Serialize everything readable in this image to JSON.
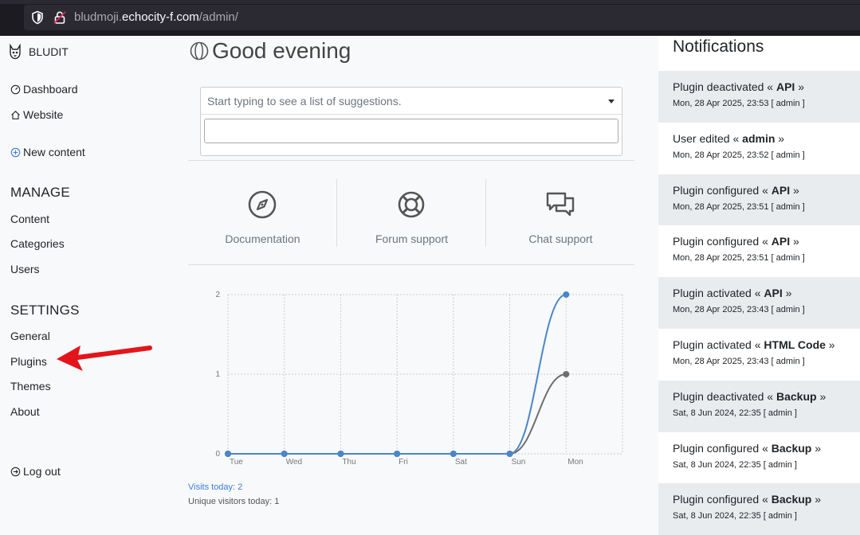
{
  "browser": {
    "url_prefix": "bludmoji.",
    "url_domain": "echocity-f.com",
    "url_path": "/admin/"
  },
  "sidebar": {
    "brand": "BLUDIT",
    "dashboard": "Dashboard",
    "website": "Website",
    "new_content": "New content",
    "manage_heading": "MANAGE",
    "content": "Content",
    "categories": "Categories",
    "users": "Users",
    "settings_heading": "SETTINGS",
    "general": "General",
    "plugins": "Plugins",
    "themes": "Themes",
    "about": "About",
    "logout": "Log out"
  },
  "main": {
    "greeting": "Good evening",
    "search_placeholder": "Start typing to see a list of suggestions.",
    "support": {
      "documentation": "Documentation",
      "forum": "Forum support",
      "chat": "Chat support"
    },
    "visits_today": "Visits today: 2",
    "unique_visitors": "Unique visitors today: 1"
  },
  "chart_data": {
    "type": "line",
    "categories": [
      "Tue",
      "Wed",
      "Thu",
      "Fri",
      "Sat",
      "Sun",
      "Mon"
    ],
    "series": [
      {
        "values": [
          0,
          0,
          0,
          0,
          0,
          0,
          2
        ],
        "color": "#4a86c8"
      },
      {
        "values": [
          0,
          0,
          0,
          0,
          0,
          0,
          1
        ],
        "color": "#6e6e6e"
      }
    ],
    "yticks": [
      "0",
      "1",
      "2"
    ],
    "ylim": [
      0,
      2
    ],
    "grid": true
  },
  "notifications": {
    "title": "Notifications",
    "items": [
      {
        "pre": "Plugin deactivated « ",
        "name": "API",
        "post": " »",
        "meta": "Mon, 28 Apr 2025, 23:53 [ admin ]"
      },
      {
        "pre": "User edited « ",
        "name": "admin",
        "post": " »",
        "meta": "Mon, 28 Apr 2025, 23:52 [ admin ]"
      },
      {
        "pre": "Plugin configured « ",
        "name": "API",
        "post": " »",
        "meta": "Mon, 28 Apr 2025, 23:51 [ admin ]"
      },
      {
        "pre": "Plugin configured « ",
        "name": "API",
        "post": " »",
        "meta": "Mon, 28 Apr 2025, 23:51 [ admin ]"
      },
      {
        "pre": "Plugin activated « ",
        "name": "API",
        "post": " »",
        "meta": "Mon, 28 Apr 2025, 23:43 [ admin ]"
      },
      {
        "pre": "Plugin activated « ",
        "name": "HTML Code",
        "post": " »",
        "meta": "Mon, 28 Apr 2025, 23:43 [ admin ]"
      },
      {
        "pre": "Plugin deactivated « ",
        "name": "Backup",
        "post": " »",
        "meta": "Sat, 8 Jun 2024, 22:35 [ admin ]"
      },
      {
        "pre": "Plugin configured « ",
        "name": "Backup",
        "post": " »",
        "meta": "Sat, 8 Jun 2024, 22:35 [ admin ]"
      },
      {
        "pre": "Plugin configured « ",
        "name": "Backup",
        "post": " »",
        "meta": "Sat, 8 Jun 2024, 22:35 [ admin ]"
      }
    ]
  }
}
